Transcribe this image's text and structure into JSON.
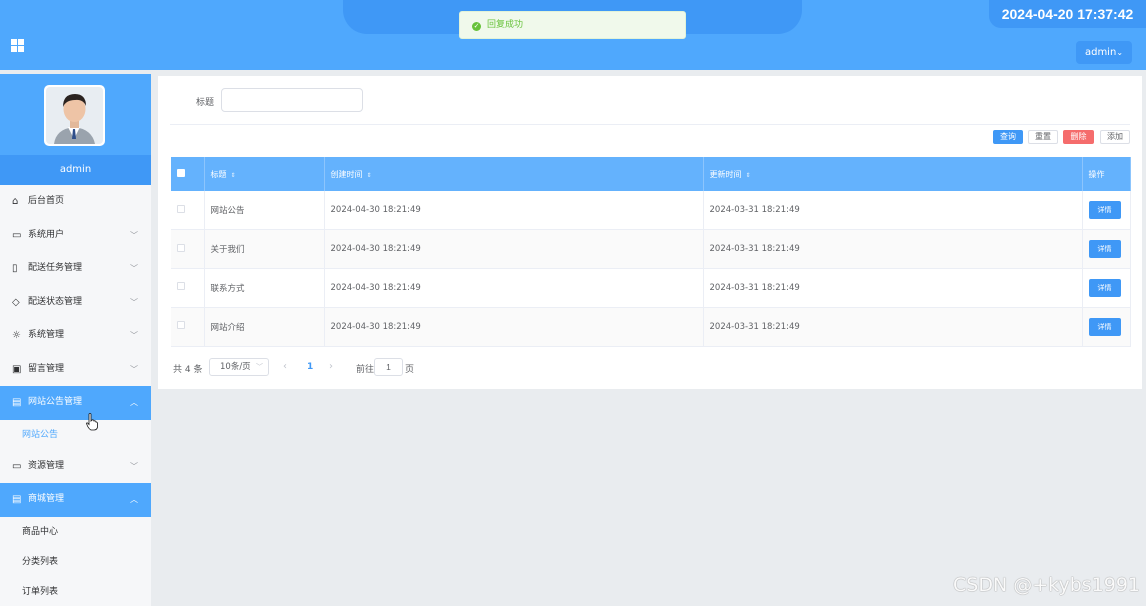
{
  "header": {
    "datetime": "2024-04-20 17:37:42",
    "user": "admin",
    "caret": "⌄"
  },
  "toast": {
    "message": "回复成功"
  },
  "sidebar": {
    "admin_name": "admin",
    "items": [
      {
        "label": "后台首页",
        "icon": "home-icon"
      },
      {
        "label": "系统用户",
        "icon": "monitor-icon"
      },
      {
        "label": "配送任务管理",
        "icon": "bookmark-icon"
      },
      {
        "label": "配送状态管理",
        "icon": "tag-icon"
      },
      {
        "label": "系统管理",
        "icon": "sun-icon"
      },
      {
        "label": "留言管理",
        "icon": "inbox-icon"
      },
      {
        "label": "网站公告管理",
        "icon": "clipboard-icon"
      },
      {
        "label": "资源管理",
        "icon": "chat-icon"
      },
      {
        "label": "商城管理",
        "icon": "box-icon"
      }
    ],
    "sub_notice": [
      "网站公告"
    ],
    "sub_shop": [
      "商品中心",
      "分类列表",
      "订单列表"
    ]
  },
  "search": {
    "label": "标题",
    "value": ""
  },
  "buttons": {
    "query": "查询",
    "reset": "重置",
    "delete": "删除",
    "add": "添加"
  },
  "table": {
    "headers": {
      "title": "标题",
      "created": "创建时间",
      "updated": "更新时间",
      "action": "操作"
    },
    "rows": [
      {
        "title": "网站公告",
        "created": "2024-04-30 18:21:49",
        "updated": "2024-03-31 18:21:49",
        "action": "详情"
      },
      {
        "title": "关于我们",
        "created": "2024-04-30 18:21:49",
        "updated": "2024-03-31 18:21:49",
        "action": "详情"
      },
      {
        "title": "联系方式",
        "created": "2024-04-30 18:21:49",
        "updated": "2024-03-31 18:21:49",
        "action": "详情"
      },
      {
        "title": "网站介绍",
        "created": "2024-04-30 18:21:49",
        "updated": "2024-03-31 18:21:49",
        "action": "详情"
      }
    ]
  },
  "pagination": {
    "total": "共 4 条",
    "page_size": "10条/页",
    "current": "1",
    "goto_label": "前往",
    "goto_value": "1",
    "page_suffix": "页"
  },
  "watermark": "CSDN @+kybs1991",
  "colors": {
    "primary": "#4fa8fd",
    "primary_dark": "#3f98f6",
    "danger": "#f56c6c",
    "success": "#67c23a"
  }
}
